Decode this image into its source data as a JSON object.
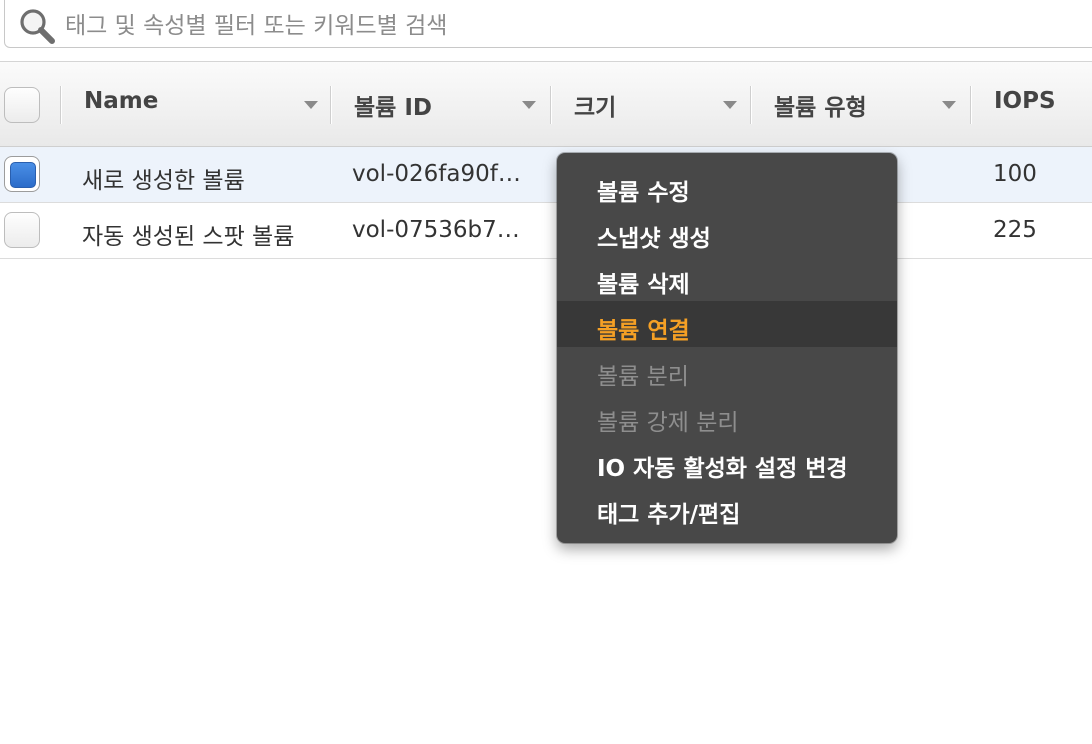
{
  "search": {
    "placeholder": "태그 및 속성별 필터 또는 키워드별 검색"
  },
  "table": {
    "columns": [
      {
        "label": "Name"
      },
      {
        "label": "볼륨 ID"
      },
      {
        "label": "크기"
      },
      {
        "label": "볼륨 유형"
      },
      {
        "label": "IOPS"
      }
    ],
    "rows": [
      {
        "name": "새로 생성한 볼륨",
        "volume_id": "vol-026fa90f…",
        "iops": "100",
        "selected": true
      },
      {
        "name": "자동 생성된 스팟 볼륨",
        "volume_id": "vol-07536b7…",
        "iops": "225",
        "selected": false
      }
    ]
  },
  "context_menu": {
    "items": [
      {
        "label": "볼륨 수정",
        "state": "enabled"
      },
      {
        "label": "스냅샷 생성",
        "state": "enabled"
      },
      {
        "label": "볼륨 삭제",
        "state": "enabled"
      },
      {
        "label": "볼륨 연결",
        "state": "highlighted"
      },
      {
        "label": "볼륨 분리",
        "state": "disabled"
      },
      {
        "label": "볼륨 강제 분리",
        "state": "disabled"
      },
      {
        "label": "IO 자동 활성화 설정 변경",
        "state": "enabled"
      },
      {
        "label": "태그 추가/편집",
        "state": "enabled"
      }
    ]
  },
  "colors": {
    "highlight_text": "#f5a025",
    "menu_background": "#484848",
    "selected_row": "#edf3fb",
    "checkbox_checked": "#2c6cc9"
  }
}
